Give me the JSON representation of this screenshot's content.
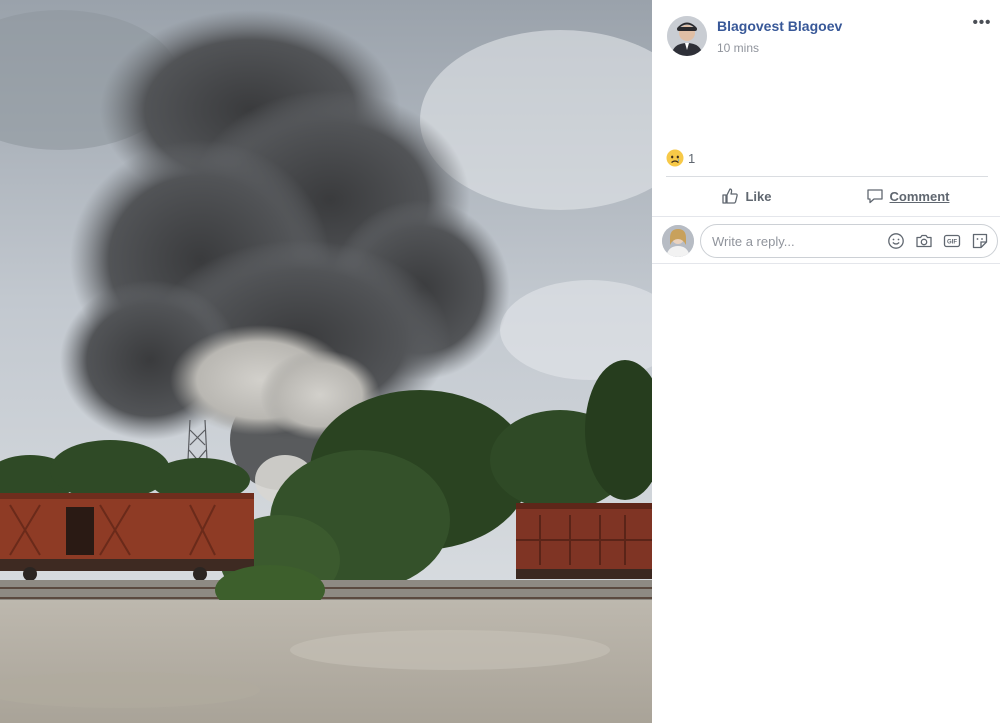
{
  "post": {
    "author_name": "Blagovest Blagoev",
    "timestamp": "10 mins",
    "more_icon": "more-horizontal-icon",
    "more_label": "•••"
  },
  "reactions": {
    "icon": "sad-reaction-icon",
    "count": "1"
  },
  "actions": {
    "like_label": "Like",
    "comment_label": "Comment"
  },
  "reply": {
    "placeholder": "Write a reply...",
    "tools": [
      "emoji-icon",
      "camera-icon",
      "gif-icon",
      "sticker-icon"
    ]
  },
  "colors": {
    "link_blue": "#385898",
    "muted_text": "#90949c",
    "divider": "#dadde1"
  }
}
